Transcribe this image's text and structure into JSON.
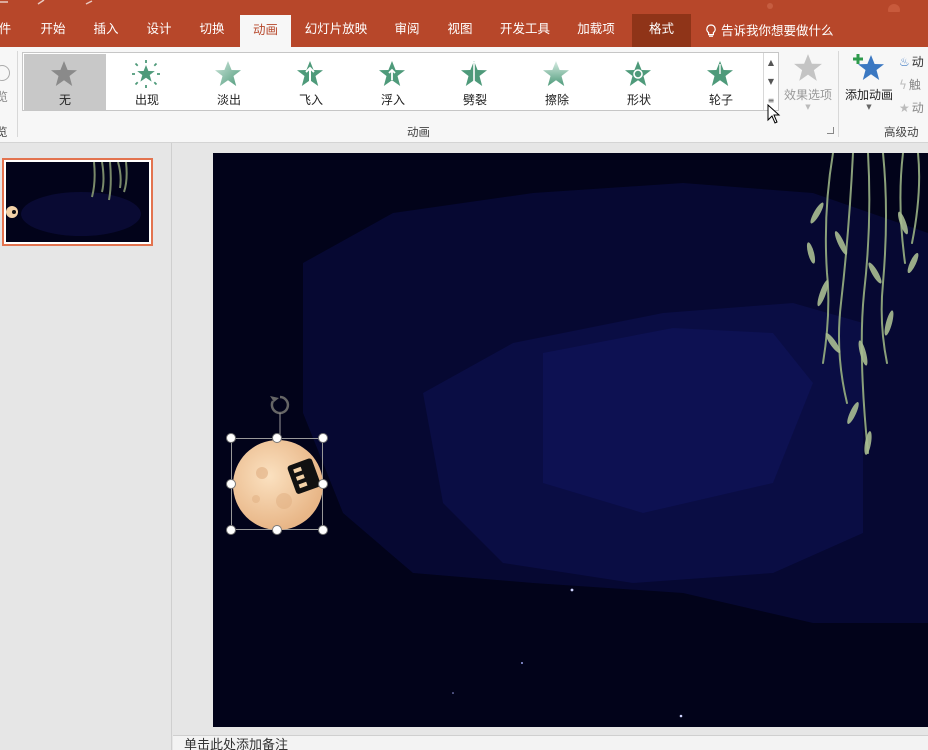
{
  "ribbon_tabs": {
    "file": "件",
    "home": "开始",
    "insert": "插入",
    "design": "设计",
    "transitions": "切换",
    "animations": "动画",
    "slideshow": "幻灯片放映",
    "review": "审阅",
    "view": "视图",
    "developer": "开发工具",
    "addins": "加载项",
    "format": "格式"
  },
  "tell_me": "告诉我你想要做什么",
  "preview_partial": "览",
  "animation_gallery": {
    "items": [
      {
        "label": "无",
        "icon": "star-none-icon",
        "selected": true
      },
      {
        "label": "出现",
        "icon": "star-appear-icon"
      },
      {
        "label": "淡出",
        "icon": "star-fade-icon"
      },
      {
        "label": "飞入",
        "icon": "star-fly-in-icon"
      },
      {
        "label": "浮入",
        "icon": "star-float-in-icon"
      },
      {
        "label": "劈裂",
        "icon": "star-split-icon"
      },
      {
        "label": "擦除",
        "icon": "star-wipe-icon"
      },
      {
        "label": "形状",
        "icon": "star-shape-icon"
      },
      {
        "label": "轮子",
        "icon": "star-wheel-icon"
      }
    ],
    "group_label": "动画"
  },
  "effect_options": "效果选项",
  "add_animation": "添加动画",
  "advanced_animation": {
    "group_label": "高级动画",
    "item1": "动",
    "item2": "触",
    "item3": "动"
  },
  "colors": {
    "accent": "#b7472a",
    "format_tab": "#8f3418",
    "slide_bg": "#02031a",
    "star_green": "#4e9a7a",
    "thumb_border": "#e3734f"
  },
  "notes_placeholder": "单击此处添加备注"
}
